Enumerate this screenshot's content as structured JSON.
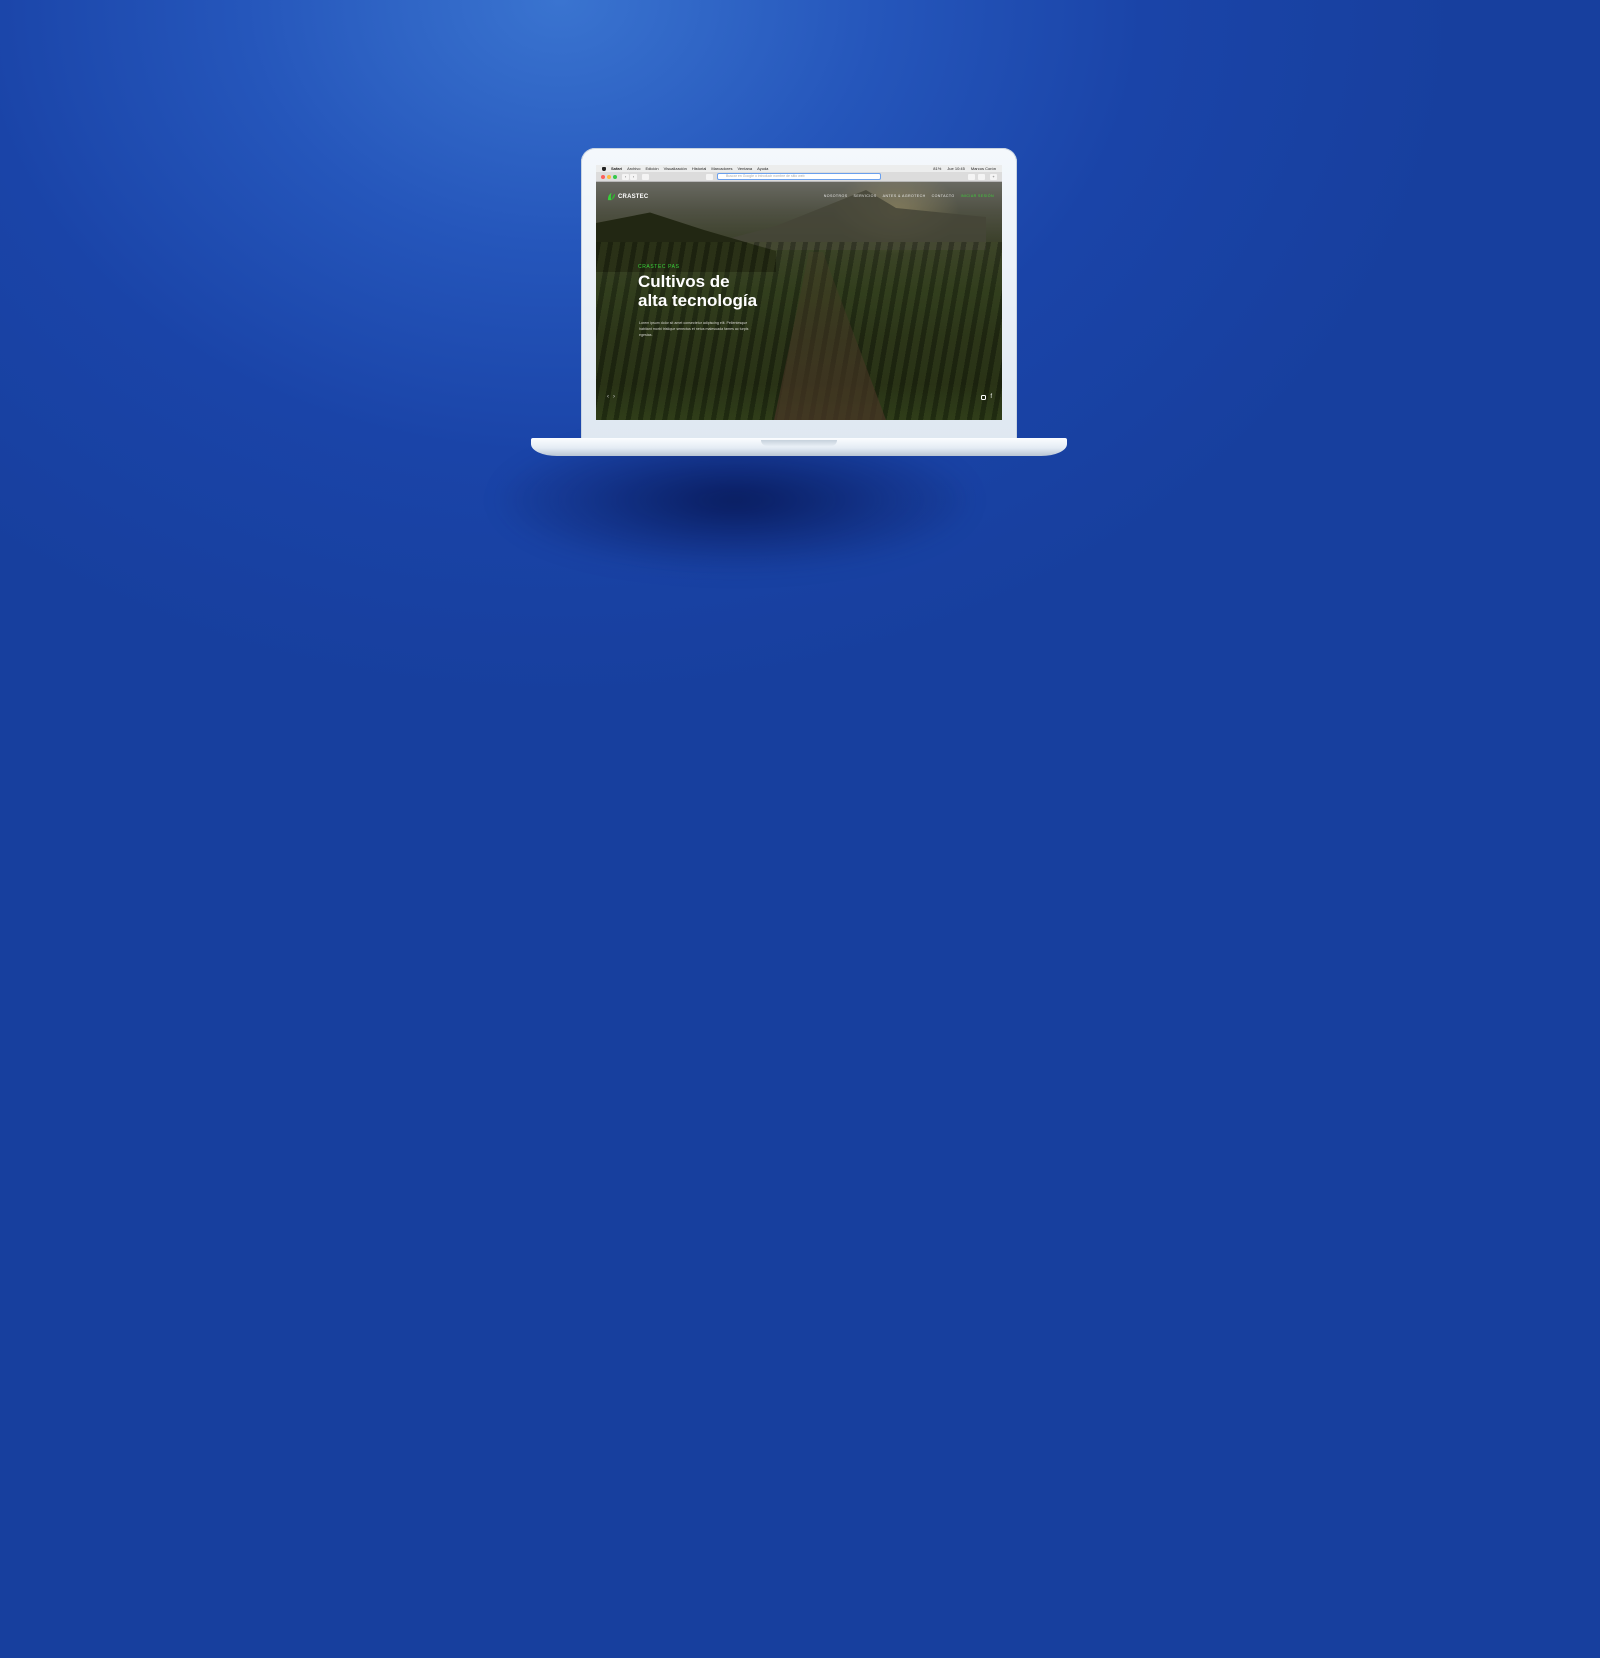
{
  "menubar": {
    "app": "Safari",
    "items": [
      "Archivo",
      "Edición",
      "Visualización",
      "Historial",
      "Marcadores",
      "Ventana",
      "Ayuda"
    ],
    "battery": "81%",
    "clock": "Jue 10:45",
    "user": "Marcos Corón"
  },
  "toolbar": {
    "address_placeholder": "Buscar en Google o introducir nombre de sitio web"
  },
  "site": {
    "logo": "CRASTEC",
    "nav": [
      "NOSOTROS",
      "SERVICIOS",
      "ANTES & AGROTECH",
      "CONTACTO",
      "INICIAR SESIÓN"
    ],
    "eyebrow": "CRASTEC PAS",
    "title_line1": "Cultivos de",
    "title_line2": "alta tecnología",
    "body": "Lorem ipsum dolor sit amet consectetur adipiscing elit. Pellentesque habitant morbi tristique senectus et netus malesuada fames ac turpis egestas."
  },
  "colors": {
    "accent": "#37d23a",
    "background": "#1a44a8"
  }
}
